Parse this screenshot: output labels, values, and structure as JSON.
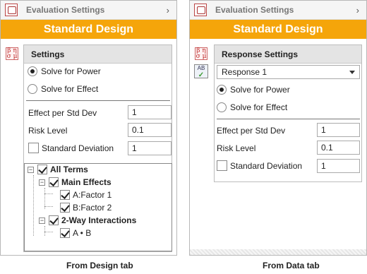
{
  "left": {
    "nav_title": "Evaluation Settings",
    "banner": "Standard Design",
    "group_title": "Settings",
    "radio_power": "Solve for Power",
    "radio_effect": "Solve for Effect",
    "effect_label": "Effect per Std Dev",
    "effect_value": "1",
    "risk_label": "Risk Level",
    "risk_value": "0.1",
    "stddev_label": "Standard Deviation",
    "stddev_value": "1",
    "tree": {
      "all_terms": "All Terms",
      "main_effects": "Main Effects",
      "factor1": "A:Factor 1",
      "factor2": "B:Factor 2",
      "two_way": "2-Way Interactions",
      "ab": "A • B"
    },
    "caption": "From Design tab"
  },
  "right": {
    "nav_title": "Evaluation Settings",
    "banner": "Standard Design",
    "group_title": "Response Settings",
    "response_selected": "Response 1",
    "radio_power": "Solve for Power",
    "radio_effect": "Solve for Effect",
    "effect_label": "Effect per Std Dev",
    "effect_value": "1",
    "risk_label": "Risk Level",
    "risk_value": "0.1",
    "stddev_label": "Standard Deviation",
    "stddev_value": "1",
    "caption": "From Data tab"
  },
  "colors": {
    "banner": "#f5a50a",
    "group_header": "#e4e4e4"
  },
  "icons": [
    "settings-nav-icon",
    "chevron-right-icon",
    "beta-sigma-mu-icon",
    "response-check-icon"
  ]
}
